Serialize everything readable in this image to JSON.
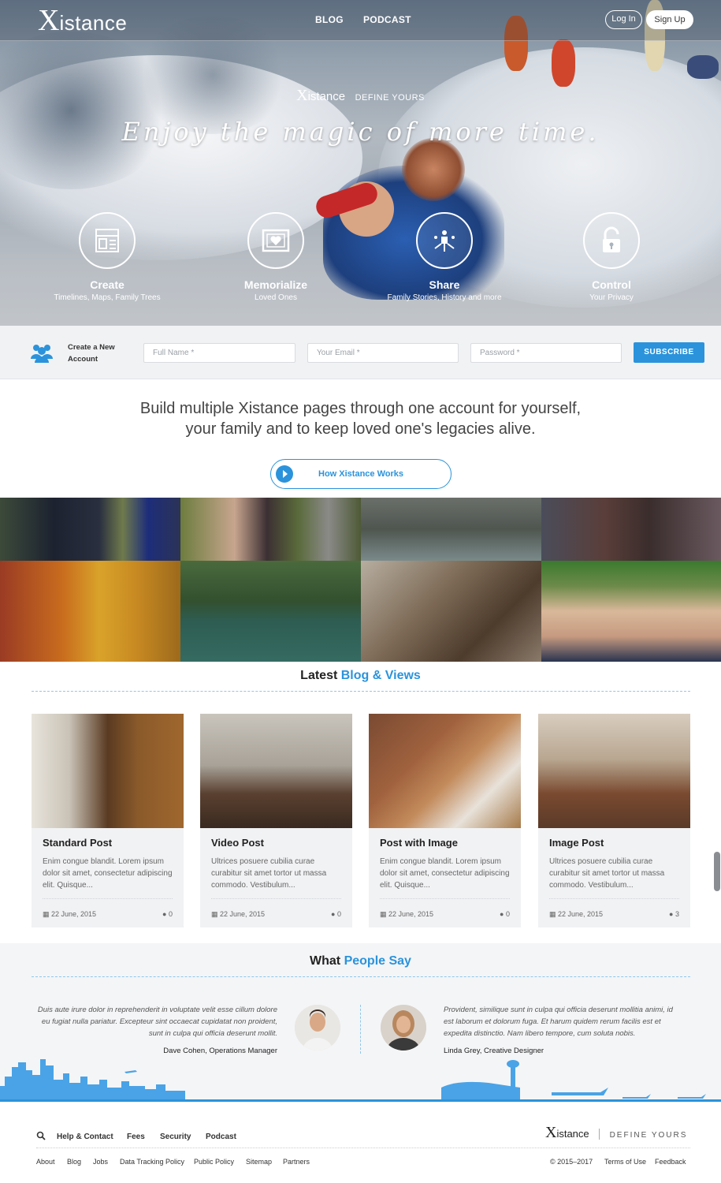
{
  "header": {
    "logo_x": "X",
    "logo_rest": "istance",
    "nav": [
      "BLOG",
      "PODCAST"
    ],
    "login": "Log In",
    "signup": "Sign Up"
  },
  "hero": {
    "brand_x": "X",
    "brand_rest": "istance",
    "define": "DEFINE YOURS",
    "headline": "Enjoy the magic of more time.",
    "features": [
      {
        "title": "Create",
        "subtitle": "Timelines, Maps, Family Trees",
        "icon": "layout-icon"
      },
      {
        "title": "Memorialize",
        "subtitle": "Loved Ones",
        "icon": "heart-frame-icon"
      },
      {
        "title": "Share",
        "subtitle": "Family Stories, History and more",
        "icon": "share-people-icon"
      },
      {
        "title": "Control",
        "subtitle": "Your Privacy",
        "icon": "lock-icon"
      }
    ]
  },
  "signup_bar": {
    "label_line1": "Create a New",
    "label_line2": "Account",
    "full_name": "Full Name *",
    "email": "Your Email *",
    "password": "Password *",
    "subscribe": "SUBSCRIBE"
  },
  "intro": {
    "line1": "Build multiple Xistance pages through one account for yourself,",
    "line2": "your family and to keep loved one's legacies alive.",
    "how_button": "How Xistance Works"
  },
  "blog": {
    "title_plain": "Latest ",
    "title_highlight": "Blog & Views",
    "cards": [
      {
        "title": "Standard Post",
        "excerpt": "Enim congue blandit. Lorem ipsum dolor sit amet, consectetur adipiscing elit. Quisque...",
        "date": "22 June, 2015",
        "comments": "0"
      },
      {
        "title": "Video Post",
        "excerpt": "Ultrices posuere cubilia curae curabitur sit amet tortor ut massa commodo. Vestibulum...",
        "date": "22 June, 2015",
        "comments": "0"
      },
      {
        "title": "Post with Image",
        "excerpt": "Enim congue blandit. Lorem ipsum dolor sit amet, consectetur adipiscing elit. Quisque...",
        "date": "22 June, 2015",
        "comments": "0"
      },
      {
        "title": "Image Post",
        "excerpt": "Ultrices posuere cubilia curae curabitur sit amet tortor ut massa commodo. Vestibulum...",
        "date": "22 June, 2015",
        "comments": "3"
      }
    ]
  },
  "testimonials": {
    "title_plain": "What ",
    "title_highlight": "People Say",
    "left": {
      "line1": "Duis aute irure dolor in reprehenderit in voluptate velit esse cillum dolore",
      "line2": "eu fugiat nulla pariatur. Excepteur sint occaecat cupidatat non proident,",
      "line3": "sunt in culpa qui officia deserunt mollit.",
      "name": "Dave Cohen, Operations Manager"
    },
    "right": {
      "line1": "Provident, similique sunt in culpa qui officia deserunt mollitia animi, id",
      "line2": "est laborum et dolorum fuga. Et harum quidem rerum facilis est et",
      "line3": "expedita distinctio. Nam libero tempore, cum soluta nobis.",
      "name": "Linda Grey, Creative Designer"
    }
  },
  "footer": {
    "main_links": [
      "Help & Contact",
      "Fees",
      "Security",
      "Podcast"
    ],
    "brand_x": "X",
    "brand_rest": "istance",
    "define": "DEFINE YOURS",
    "sub_links": [
      "About",
      "Blog",
      "Jobs",
      "Data Tracking Policy",
      "Public Policy",
      "Sitemap",
      "Partners"
    ],
    "copyright": "© 2015–2017",
    "terms": "Terms of Use",
    "feedback": "Feedback"
  },
  "colors": {
    "accent": "#2b93db",
    "signup_bg": "#f1f2f4"
  }
}
